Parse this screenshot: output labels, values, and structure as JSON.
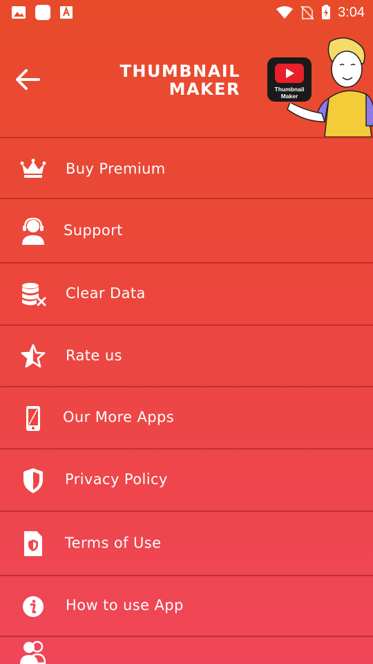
{
  "status_bar": {
    "time": "3:04",
    "icons": [
      "image-icon",
      "square-app-icon",
      "text-app-icon",
      "wifi-icon",
      "no-sim-icon",
      "battery-charging-icon"
    ]
  },
  "header": {
    "back_icon": "arrow-left-icon",
    "title_line1": "THUMBNAIL",
    "title_line2": "MAKER",
    "badge_text_line1": "Thumbnail",
    "badge_text_line2": "Maker"
  },
  "menu": {
    "items": [
      {
        "label": "Buy Premium",
        "icon": "crown-icon"
      },
      {
        "label": "Support",
        "icon": "headset-user-icon"
      },
      {
        "label": "Clear Data",
        "icon": "database-remove-icon"
      },
      {
        "label": "Rate us",
        "icon": "star-icon"
      },
      {
        "label": "Our More Apps",
        "icon": "phone-icon"
      },
      {
        "label": "Privacy Policy",
        "icon": "shield-icon"
      },
      {
        "label": "Terms of Use",
        "icon": "document-shield-icon"
      },
      {
        "label": "How to use App",
        "icon": "info-icon"
      },
      {
        "label": "",
        "icon": "users-icon"
      }
    ]
  },
  "colors": {
    "top": "#E84B2A",
    "bottom": "#F04659",
    "divider": "#B6282A"
  }
}
